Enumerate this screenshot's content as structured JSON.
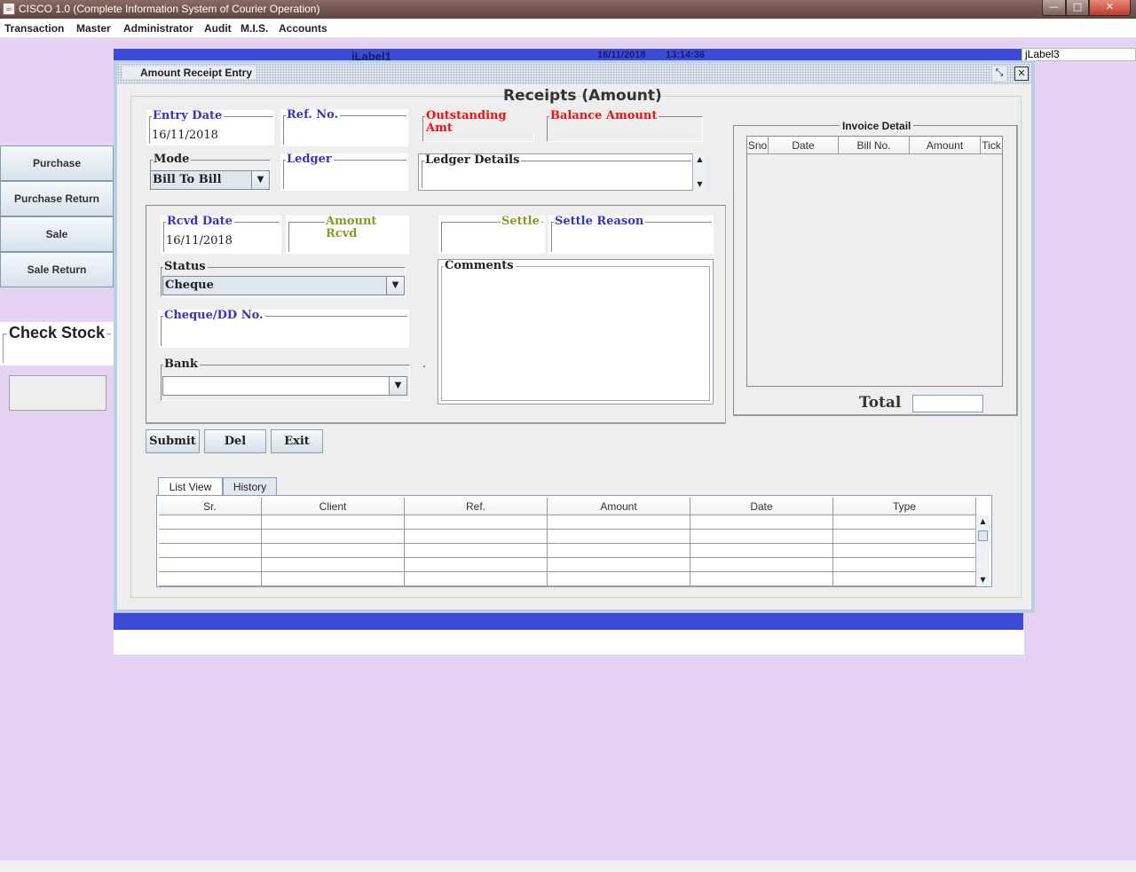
{
  "window": {
    "title": "CISCO 1.0 (Complete Information System of Courier Operation)",
    "min_label": "—",
    "max_label": "□",
    "close_label": "✕"
  },
  "menubar": {
    "items": [
      "Transaction",
      "Master",
      "Administrator",
      "Audit",
      "M.I.S.",
      "Accounts"
    ]
  },
  "background": {
    "label1": "jLabel1",
    "date": "16/11/2018",
    "time": "13:14:36",
    "label3": "jLabel3"
  },
  "sidebar": {
    "buttons": [
      "Purchase",
      "Purchase Return",
      "Sale",
      "Sale Return"
    ],
    "check_stock": "Check Stock"
  },
  "dialog": {
    "title": "Amount Receipt Entry",
    "restore_icon": "⤡",
    "close_icon": "✕",
    "heading": "Receipts (Amount)",
    "fields": {
      "entry_date_label": "Entry Date",
      "entry_date_value": "16/11/2018",
      "ref_no_label": "Ref. No.",
      "outstanding_label": "Outstanding Amt",
      "balance_label": "Balance Amount",
      "mode_label": "Mode",
      "mode_value": "Bill To Bill",
      "ledger_label": "Ledger",
      "ledger_details_label": "Ledger Details",
      "rcvd_date_label": "Rcvd Date",
      "rcvd_date_value": "16/11/2018",
      "amount_rcvd_label": "Amount Rcvd",
      "settle_label": "Settle",
      "settle_reason_label": "Settle Reason",
      "status_label": "Status",
      "status_value": "Cheque",
      "comments_label": "Comments",
      "cheque_label": "Cheque/DD No.",
      "bank_label": "Bank",
      "bank_value": "",
      "dot": "."
    },
    "invoice": {
      "title": "Invoice Detail",
      "columns": [
        "Sno",
        "Date",
        "Bill No.",
        "Amount",
        "Tick"
      ],
      "total_label": "Total"
    },
    "buttons": {
      "submit": "Submit",
      "del": "Del",
      "exit": "Exit"
    },
    "tabs": [
      "List View",
      "History"
    ],
    "table": {
      "columns": [
        "Sr.",
        "Client",
        "Ref.",
        "Amount",
        "Date",
        "Type"
      ]
    },
    "arrows": {
      "down": "▼",
      "up": "▲"
    }
  }
}
